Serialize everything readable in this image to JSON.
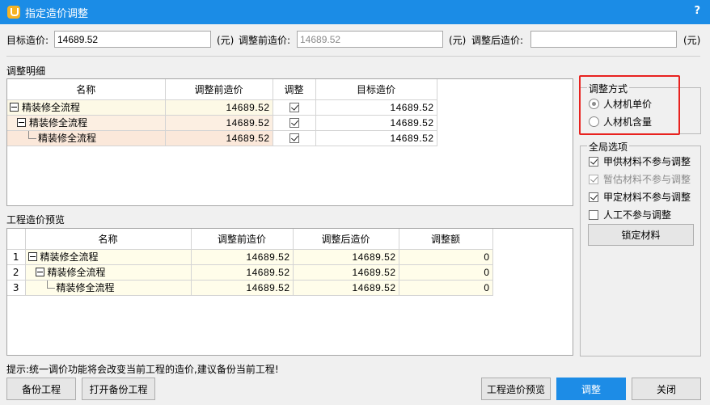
{
  "window": {
    "title": "指定造价调整",
    "help_label": "?"
  },
  "top": {
    "target_label": "目标造价:",
    "target_value": "14689.52",
    "unit": "(元)",
    "before_label": "调整前造价:",
    "before_value": "14689.52",
    "after_label": "调整后造价:",
    "after_value": ""
  },
  "detail": {
    "section_title": "调整明细",
    "columns": [
      "名称",
      "调整前造价",
      "调整",
      "目标造价"
    ],
    "rows": [
      {
        "name": "精装修全流程",
        "before": "14689.52",
        "checked": true,
        "target": "14689.52"
      },
      {
        "name": "精装修全流程",
        "before": "14689.52",
        "checked": true,
        "target": "14689.52"
      },
      {
        "name": "精装修全流程",
        "before": "14689.52",
        "checked": true,
        "target": "14689.52"
      }
    ]
  },
  "preview": {
    "section_title": "工程造价预览",
    "columns": [
      "名称",
      "调整前造价",
      "调整后造价",
      "调整额"
    ],
    "rows": [
      {
        "no": "1",
        "name": "精装修全流程",
        "before": "14689.52",
        "after": "14689.52",
        "diff": "0"
      },
      {
        "no": "2",
        "name": "精装修全流程",
        "before": "14689.52",
        "after": "14689.52",
        "diff": "0"
      },
      {
        "no": "3",
        "name": "精装修全流程",
        "before": "14689.52",
        "after": "14689.52",
        "diff": "0"
      }
    ]
  },
  "method": {
    "title": "调整方式",
    "options": [
      {
        "label": "人材机单价",
        "selected": true
      },
      {
        "label": "人材机含量",
        "selected": false
      }
    ]
  },
  "global": {
    "title": "全局选项",
    "options": [
      {
        "label": "甲供材料不参与调整",
        "checked": true,
        "disabled": false
      },
      {
        "label": "暂估材料不参与调整",
        "checked": true,
        "disabled": true
      },
      {
        "label": "甲定材料不参与调整",
        "checked": true,
        "disabled": false
      },
      {
        "label": "人工不参与调整",
        "checked": false,
        "disabled": false
      }
    ],
    "lock_button": "锁定材料"
  },
  "hint": "提示:统一调价功能将会改变当前工程的造价,建议备份当前工程!",
  "buttons": {
    "backup": "备份工程",
    "open_backup": "打开备份工程",
    "preview": "工程造价预览",
    "adjust": "调整",
    "close": "关闭"
  },
  "colors": {
    "titlebar": "#1b8ce6",
    "primary": "#1d8ce6",
    "highlight": "#e8221f"
  }
}
